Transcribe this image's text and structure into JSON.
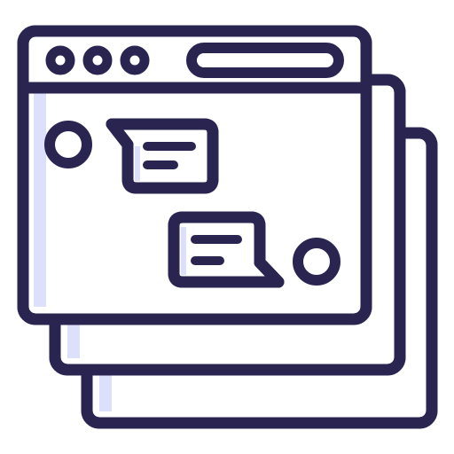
{
  "icon": {
    "name": "chat-windows-icon",
    "colors": {
      "outline": "#2a2450",
      "shade": "#dde0fb",
      "fill": "#ffffff"
    },
    "parts": [
      "back-window-icon",
      "middle-window-icon",
      "front-window-icon",
      "window-control-dots-icon",
      "address-bar-icon",
      "avatar-icon",
      "chat-bubble-icon"
    ]
  }
}
